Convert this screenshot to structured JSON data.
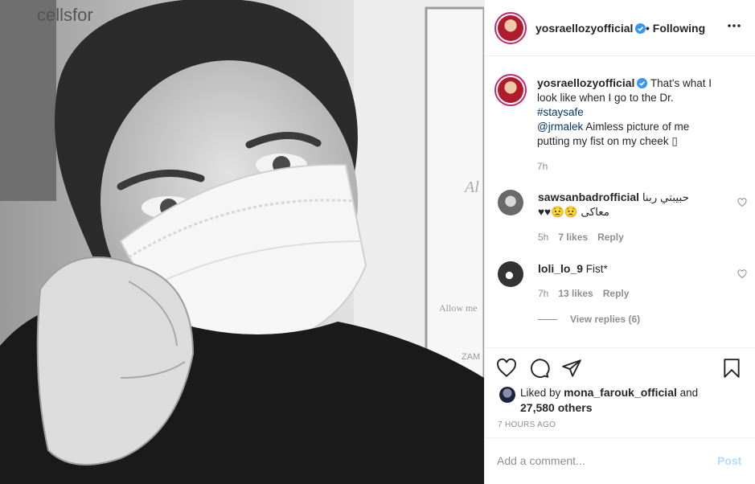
{
  "post": {
    "username": "yosraellozyofficial",
    "follow_status": "Following",
    "caption_text": "That's what I look like when I go to the Dr.",
    "hashtag": "#staysafe",
    "mention": "@jrmalek",
    "caption_rest": "Aimless picture of me putting my fist on my cheek ▯",
    "caption_time": "7h",
    "photo_bg_text_1": "cellsfor",
    "photo_bg_text_2": "Al",
    "photo_bg_text_3": "Allow me",
    "photo_bg_text_4": "ZAM"
  },
  "comments": [
    {
      "username": "sawsanbadrofficial",
      "text": "حبيبتي ربنا معاكى 😟😟♥♥",
      "time": "5h",
      "likes": "7 likes",
      "reply": "Reply"
    },
    {
      "username": "loli_lo_9",
      "text": "Fist*",
      "time": "7h",
      "likes": "13 likes",
      "reply": "Reply"
    }
  ],
  "view_replies": "View replies (6)",
  "likes": {
    "prefix": "Liked by",
    "user": "mona_farouk_official",
    "middle": "and",
    "others": "27,580 others"
  },
  "posted_ago": "7 HOURS AGO",
  "add_comment": {
    "placeholder": "Add a comment...",
    "post_label": "Post"
  },
  "icons": [
    "verified-badge-icon",
    "more-options-icon",
    "heart-icon",
    "comment-icon",
    "share-icon",
    "bookmark-icon"
  ],
  "colors": {
    "verified": "#3897f0",
    "link": "#00376b",
    "muted": "#8e8e8e",
    "post_disabled": "#b3dbff",
    "avatar_ring": "#c9266b"
  }
}
